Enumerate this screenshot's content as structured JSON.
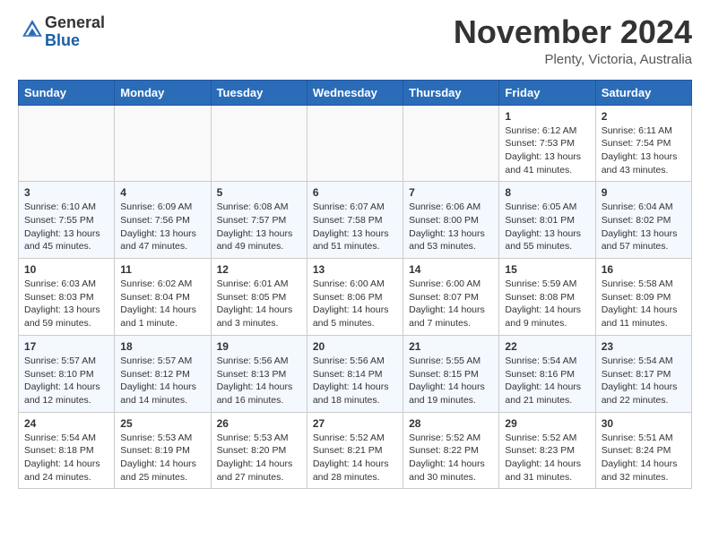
{
  "header": {
    "logo_general": "General",
    "logo_blue": "Blue",
    "month_title": "November 2024",
    "location": "Plenty, Victoria, Australia"
  },
  "calendar": {
    "headers": [
      "Sunday",
      "Monday",
      "Tuesday",
      "Wednesday",
      "Thursday",
      "Friday",
      "Saturday"
    ],
    "weeks": [
      [
        {
          "day": "",
          "info": ""
        },
        {
          "day": "",
          "info": ""
        },
        {
          "day": "",
          "info": ""
        },
        {
          "day": "",
          "info": ""
        },
        {
          "day": "",
          "info": ""
        },
        {
          "day": "1",
          "info": "Sunrise: 6:12 AM\nSunset: 7:53 PM\nDaylight: 13 hours\nand 41 minutes."
        },
        {
          "day": "2",
          "info": "Sunrise: 6:11 AM\nSunset: 7:54 PM\nDaylight: 13 hours\nand 43 minutes."
        }
      ],
      [
        {
          "day": "3",
          "info": "Sunrise: 6:10 AM\nSunset: 7:55 PM\nDaylight: 13 hours\nand 45 minutes."
        },
        {
          "day": "4",
          "info": "Sunrise: 6:09 AM\nSunset: 7:56 PM\nDaylight: 13 hours\nand 47 minutes."
        },
        {
          "day": "5",
          "info": "Sunrise: 6:08 AM\nSunset: 7:57 PM\nDaylight: 13 hours\nand 49 minutes."
        },
        {
          "day": "6",
          "info": "Sunrise: 6:07 AM\nSunset: 7:58 PM\nDaylight: 13 hours\nand 51 minutes."
        },
        {
          "day": "7",
          "info": "Sunrise: 6:06 AM\nSunset: 8:00 PM\nDaylight: 13 hours\nand 53 minutes."
        },
        {
          "day": "8",
          "info": "Sunrise: 6:05 AM\nSunset: 8:01 PM\nDaylight: 13 hours\nand 55 minutes."
        },
        {
          "day": "9",
          "info": "Sunrise: 6:04 AM\nSunset: 8:02 PM\nDaylight: 13 hours\nand 57 minutes."
        }
      ],
      [
        {
          "day": "10",
          "info": "Sunrise: 6:03 AM\nSunset: 8:03 PM\nDaylight: 13 hours\nand 59 minutes."
        },
        {
          "day": "11",
          "info": "Sunrise: 6:02 AM\nSunset: 8:04 PM\nDaylight: 14 hours\nand 1 minute."
        },
        {
          "day": "12",
          "info": "Sunrise: 6:01 AM\nSunset: 8:05 PM\nDaylight: 14 hours\nand 3 minutes."
        },
        {
          "day": "13",
          "info": "Sunrise: 6:00 AM\nSunset: 8:06 PM\nDaylight: 14 hours\nand 5 minutes."
        },
        {
          "day": "14",
          "info": "Sunrise: 6:00 AM\nSunset: 8:07 PM\nDaylight: 14 hours\nand 7 minutes."
        },
        {
          "day": "15",
          "info": "Sunrise: 5:59 AM\nSunset: 8:08 PM\nDaylight: 14 hours\nand 9 minutes."
        },
        {
          "day": "16",
          "info": "Sunrise: 5:58 AM\nSunset: 8:09 PM\nDaylight: 14 hours\nand 11 minutes."
        }
      ],
      [
        {
          "day": "17",
          "info": "Sunrise: 5:57 AM\nSunset: 8:10 PM\nDaylight: 14 hours\nand 12 minutes."
        },
        {
          "day": "18",
          "info": "Sunrise: 5:57 AM\nSunset: 8:12 PM\nDaylight: 14 hours\nand 14 minutes."
        },
        {
          "day": "19",
          "info": "Sunrise: 5:56 AM\nSunset: 8:13 PM\nDaylight: 14 hours\nand 16 minutes."
        },
        {
          "day": "20",
          "info": "Sunrise: 5:56 AM\nSunset: 8:14 PM\nDaylight: 14 hours\nand 18 minutes."
        },
        {
          "day": "21",
          "info": "Sunrise: 5:55 AM\nSunset: 8:15 PM\nDaylight: 14 hours\nand 19 minutes."
        },
        {
          "day": "22",
          "info": "Sunrise: 5:54 AM\nSunset: 8:16 PM\nDaylight: 14 hours\nand 21 minutes."
        },
        {
          "day": "23",
          "info": "Sunrise: 5:54 AM\nSunset: 8:17 PM\nDaylight: 14 hours\nand 22 minutes."
        }
      ],
      [
        {
          "day": "24",
          "info": "Sunrise: 5:54 AM\nSunset: 8:18 PM\nDaylight: 14 hours\nand 24 minutes."
        },
        {
          "day": "25",
          "info": "Sunrise: 5:53 AM\nSunset: 8:19 PM\nDaylight: 14 hours\nand 25 minutes."
        },
        {
          "day": "26",
          "info": "Sunrise: 5:53 AM\nSunset: 8:20 PM\nDaylight: 14 hours\nand 27 minutes."
        },
        {
          "day": "27",
          "info": "Sunrise: 5:52 AM\nSunset: 8:21 PM\nDaylight: 14 hours\nand 28 minutes."
        },
        {
          "day": "28",
          "info": "Sunrise: 5:52 AM\nSunset: 8:22 PM\nDaylight: 14 hours\nand 30 minutes."
        },
        {
          "day": "29",
          "info": "Sunrise: 5:52 AM\nSunset: 8:23 PM\nDaylight: 14 hours\nand 31 minutes."
        },
        {
          "day": "30",
          "info": "Sunrise: 5:51 AM\nSunset: 8:24 PM\nDaylight: 14 hours\nand 32 minutes."
        }
      ]
    ]
  }
}
